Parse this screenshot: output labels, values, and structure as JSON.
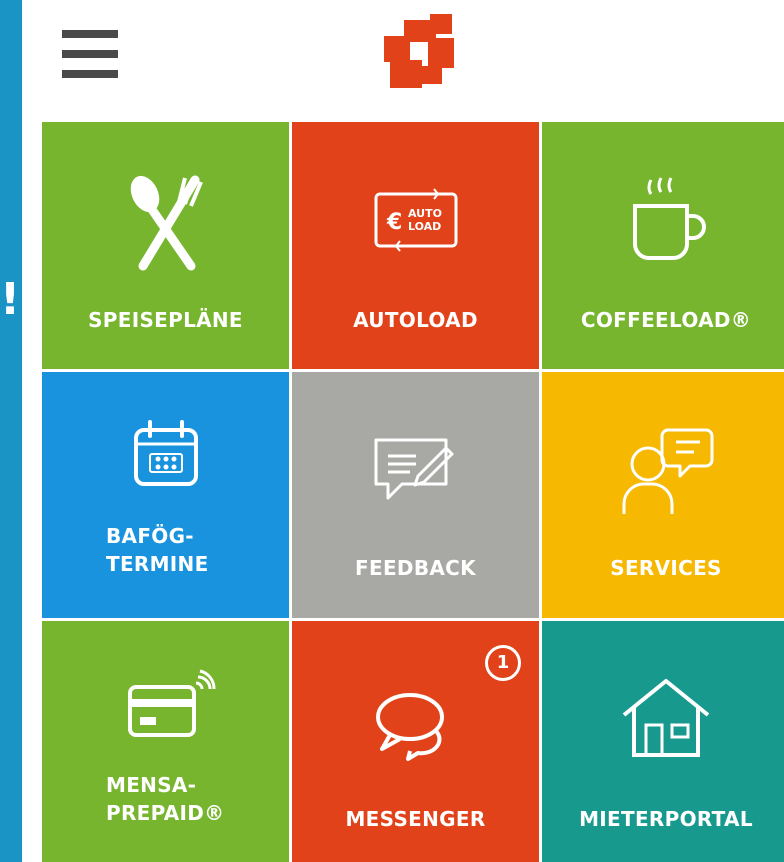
{
  "app": {
    "logo": "app-logo",
    "side_mark": "!"
  },
  "colors": {
    "background": "#1a93c5",
    "green": "#77b52e",
    "red": "#e2421a",
    "blue": "#1a93de",
    "gray": "#a8a9a4",
    "yellow": "#f6b800",
    "teal": "#179a8d"
  },
  "tiles": [
    {
      "label": "SPEISEPLÄNE",
      "icon": "cutlery-icon"
    },
    {
      "label": "AUTOLOAD",
      "icon": "autoload-card-icon",
      "icon_text_a": "AUTO",
      "icon_text_b": "LOAD"
    },
    {
      "label": "COFFEELOAD®",
      "icon": "coffee-cup-icon"
    },
    {
      "label": "BAFÖG-",
      "label_line2": "TERMINE",
      "icon": "calendar-icon"
    },
    {
      "label": "FEEDBACK",
      "icon": "feedback-speech-icon"
    },
    {
      "label": "SERVICES",
      "icon": "support-person-icon"
    },
    {
      "label": "MENSA-",
      "label_line2": "PREPAID®",
      "icon": "contactless-card-icon"
    },
    {
      "label": "MESSENGER",
      "icon": "chat-bubbles-icon",
      "badge": "1"
    },
    {
      "label": "MIETERPORTAL",
      "icon": "house-icon"
    }
  ]
}
